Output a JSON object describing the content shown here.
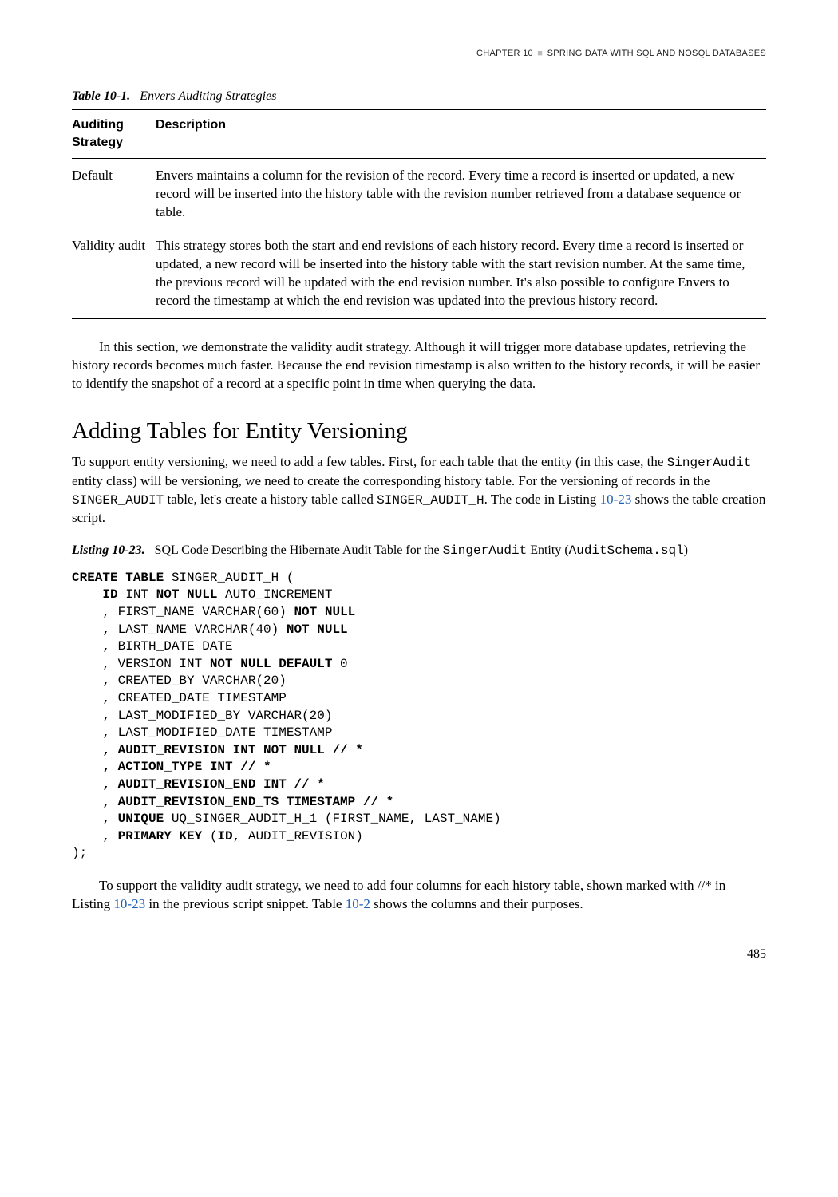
{
  "runningHead": {
    "chapter": "CHAPTER 10",
    "title": "SPRING DATA WITH SQL AND NOSQL DATABASES"
  },
  "table": {
    "captionNumber": "Table 10-1.",
    "captionTitle": "Envers Auditing Strategies",
    "header": {
      "col1": "Auditing Strategy",
      "col2": "Description"
    },
    "rows": [
      {
        "strategy": "Default",
        "desc": "Envers maintains a column for the revision of the record. Every time a record is inserted or updated, a new record will be inserted into the history table with the revision number retrieved from a database sequence or table."
      },
      {
        "strategy": "Validity audit",
        "desc": "This strategy stores both the start and end revisions of each history record. Every time a record is inserted or updated, a new record will be inserted into the history table with the start revision number. At the same time, the previous record will be updated with the end revision number. It's also possible to configure Envers to record the timestamp at which the end revision was updated into the previous history record."
      }
    ]
  },
  "para1": "In this section, we demonstrate the validity audit strategy. Although it will trigger more database updates, retrieving the history records becomes much faster. Because the end revision timestamp is also written to the history records, it will be easier to identify the snapshot of a record at a specific point in time when querying the data.",
  "sectionHeading": "Adding Tables for Entity Versioning",
  "para2": {
    "p1": "To support entity versioning, we need to add a few tables. First, for each table that the entity (in this case, the ",
    "c1": "SingerAudit",
    "p2": " entity class) will be versioning, we need to create the corresponding history table. For the versioning of records in the ",
    "c2": "SINGER_AUDIT",
    "p3": " table, let's create a history table called ",
    "c3": "SINGER_AUDIT_H",
    "p4": ". The code in Listing ",
    "link1": "10-23",
    "p5": " shows the table creation script."
  },
  "listing": {
    "captionNumber": "Listing 10-23.",
    "captionText": "SQL Code Describing the Hibernate Audit Table for the ",
    "captionCode1": "SingerAudit",
    "captionText2": " Entity (",
    "captionCode2": "AuditSchema.sql",
    "captionText3": ")"
  },
  "code": {
    "l1a": "CREATE TABLE",
    "l1b": " SINGER_AUDIT_H (",
    "l2a": "    ID",
    "l2b": " INT ",
    "l2c": "NOT NULL",
    "l2d": " AUTO_INCREMENT",
    "l3a": "    , FIRST_NAME VARCHAR(60) ",
    "l3b": "NOT NULL",
    "l4a": "    , LAST_NAME VARCHAR(40) ",
    "l4b": "NOT NULL",
    "l5": "    , BIRTH_DATE DATE",
    "l6a": "    , VERSION INT ",
    "l6b": "NOT NULL DEFAULT",
    "l6c": " 0",
    "l7": "    , CREATED_BY VARCHAR(20)",
    "l8": "    , CREATED_DATE TIMESTAMP",
    "l9": "    , LAST_MODIFIED_BY VARCHAR(20)",
    "l10": "    , LAST_MODIFIED_DATE TIMESTAMP",
    "l11": "    , AUDIT_REVISION INT NOT NULL // *",
    "l12": "    , ACTION_TYPE INT // *",
    "l13": "    , AUDIT_REVISION_END INT // *",
    "l14": "    , AUDIT_REVISION_END_TS TIMESTAMP // *",
    "l15a": "    , ",
    "l15b": "UNIQUE",
    "l15c": " UQ_SINGER_AUDIT_H_1 (FIRST_NAME, LAST_NAME)",
    "l16a": "    , ",
    "l16b": "PRIMARY KEY",
    "l16c": " (",
    "l16d": "ID",
    "l16e": ", AUDIT_REVISION)",
    "l17": ");"
  },
  "para3": {
    "p1": "To support the validity audit strategy, we need to add four columns for each history table, shown marked with //* in Listing ",
    "link1": "10-23",
    "p2": " in the previous script snippet. Table ",
    "link2": "10-2",
    "p3": " shows the columns and their purposes."
  },
  "pageNumber": "485"
}
